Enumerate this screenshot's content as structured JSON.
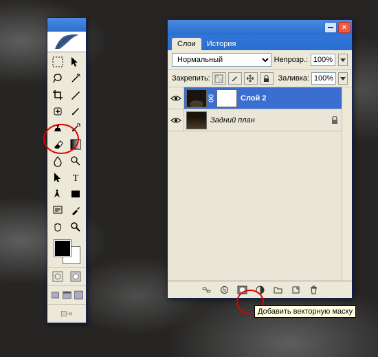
{
  "toolbox": {
    "tools": [
      "move",
      "marquee",
      "lasso",
      "magic-wand",
      "crop",
      "slice",
      "healing-brush",
      "brush",
      "clone-stamp",
      "history-brush",
      "eraser",
      "gradient",
      "blur",
      "dodge",
      "path-selection",
      "type",
      "pen",
      "shape",
      "notes",
      "eyedropper",
      "hand",
      "zoom"
    ],
    "foreground_color": "#000000",
    "background_color": "#ffffff",
    "mode_buttons": [
      "standard-mode",
      "quick-mask-mode"
    ],
    "screen_buttons": [
      "standard-screen",
      "full-screen-menu",
      "full-screen"
    ],
    "jump_button": "imageready"
  },
  "layers_panel": {
    "tabs": {
      "layers": "Слои",
      "history": "История"
    },
    "blend_mode": "Нормальный",
    "opacity_label": "Непрозр.:",
    "opacity_value": "100%",
    "lock_label": "Закрепить:",
    "fill_label": "Заливка:",
    "fill_value": "100%",
    "layers": [
      {
        "name": "Слой 2",
        "selected": true,
        "has_mask": true
      },
      {
        "name": "Задний план",
        "selected": false,
        "italic": true,
        "locked": true
      }
    ],
    "footer_buttons": [
      "link",
      "layer-style",
      "add-mask",
      "adjustment",
      "group",
      "new-layer",
      "delete"
    ],
    "tooltip": "Добавить векторную маску"
  },
  "annotations": {
    "circle1_target": "gradient-tool",
    "circle2_target": "add-mask-button"
  }
}
